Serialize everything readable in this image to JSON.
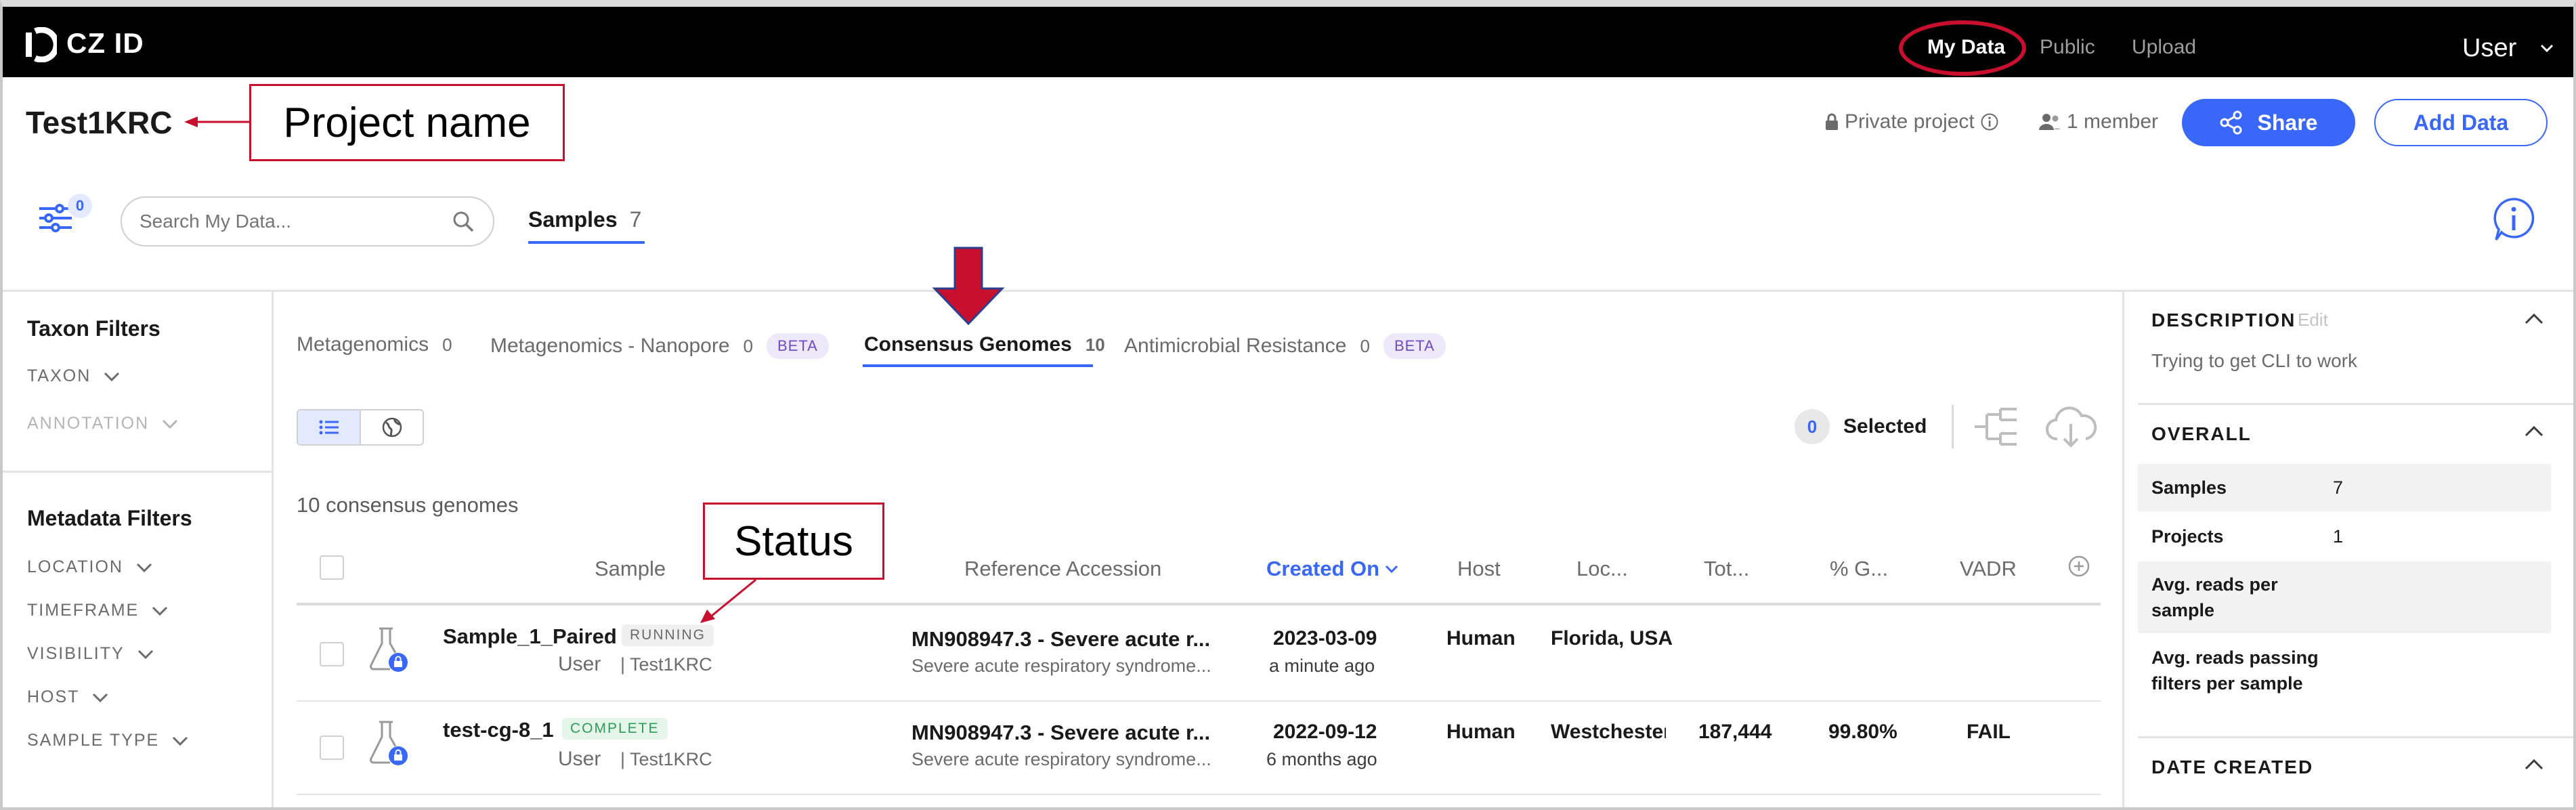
{
  "nav": {
    "logo": "CZ ID",
    "links": [
      "My Data",
      "Public",
      "Upload"
    ],
    "user": "User"
  },
  "project": {
    "name": "Test1KRC",
    "privacy": "Private project",
    "members": "1 member",
    "share_label": "Share",
    "add_data_label": "Add Data"
  },
  "annotations": {
    "project_name": "Project name",
    "status": "Status"
  },
  "toolbar": {
    "filter_count": "0",
    "search_placeholder": "Search My Data...",
    "samples_tab": "Samples",
    "samples_count": "7"
  },
  "sidebar": {
    "taxon_heading": "Taxon Filters",
    "taxon_items": [
      "TAXON",
      "ANNOTATION"
    ],
    "metadata_heading": "Metadata Filters",
    "metadata_items": [
      "LOCATION",
      "TIMEFRAME",
      "VISIBILITY",
      "HOST",
      "SAMPLE TYPE"
    ]
  },
  "workflow_tabs": [
    {
      "label": "Metagenomics",
      "count": "0",
      "badge": ""
    },
    {
      "label": "Metagenomics - Nanopore",
      "count": "0",
      "badge": "BETA"
    },
    {
      "label": "Consensus Genomes",
      "count": "10",
      "badge": ""
    },
    {
      "label": "Antimicrobial Resistance",
      "count": "0",
      "badge": "BETA"
    }
  ],
  "selection": {
    "count": "0",
    "label": "Selected"
  },
  "result_count": "10 consensus genomes",
  "table": {
    "headers": [
      "Sample",
      "Reference Accession",
      "Created On",
      "Host",
      "Loc...",
      "Tot...",
      "% G...",
      "VADR"
    ],
    "rows": [
      {
        "sample": "Sample_1_Paired",
        "status": "RUNNING",
        "user": "User",
        "project": "| Test1KRC",
        "ref_title": "MN908947.3 - Severe acute r...",
        "ref_sub": "Severe acute respiratory syndrome...",
        "date": "2023-03-09",
        "date_rel": "a minute ago",
        "host": "Human",
        "location": "Florida, USA",
        "total": "",
        "pct": "",
        "vadr": ""
      },
      {
        "sample": "test-cg-8_1",
        "status": "COMPLETE",
        "user": "User",
        "project": "| Test1KRC",
        "ref_title": "MN908947.3 - Severe acute r...",
        "ref_sub": "Severe acute respiratory syndrome...",
        "date": "2022-09-12",
        "date_rel": "6 months ago",
        "host": "Human",
        "location": "Westchester",
        "total": "187,444",
        "pct": "99.80%",
        "vadr": "FAIL"
      }
    ]
  },
  "details": {
    "description_heading": "DESCRIPTION",
    "edit_label": "Edit",
    "description": "Trying to get CLI to work",
    "overall_heading": "OVERALL",
    "stats": [
      {
        "label": "Samples",
        "value": "7"
      },
      {
        "label": "Projects",
        "value": "1"
      },
      {
        "label": "Avg. reads per sample",
        "value": ""
      },
      {
        "label": "Avg. reads passing filters per sample",
        "value": ""
      }
    ],
    "date_heading": "DATE CREATED"
  },
  "colors": {
    "accent": "#3867fa",
    "annotation": "#c8102e",
    "nav_bg": "#000000"
  }
}
